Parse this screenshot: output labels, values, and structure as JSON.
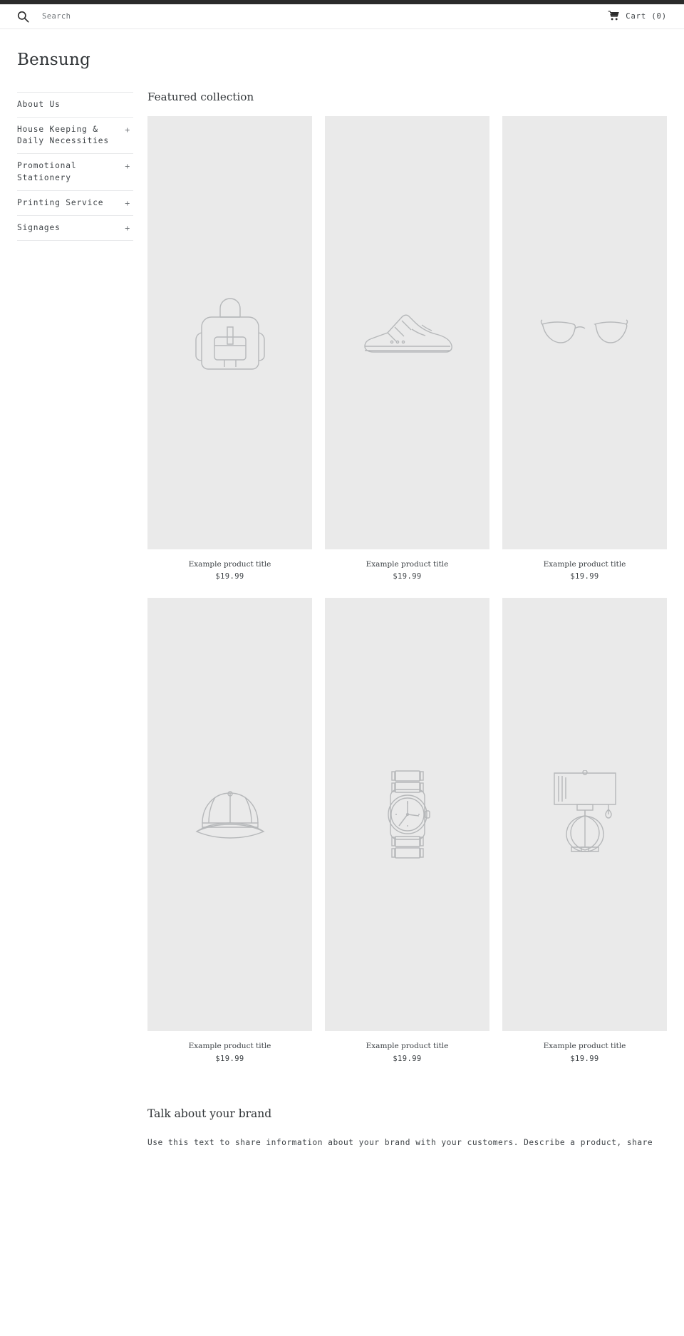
{
  "topbar": {
    "color": "#2b2b2b"
  },
  "header": {
    "search": {
      "icon": "search-icon",
      "placeholder": "Search",
      "value": ""
    },
    "cart": {
      "icon": "shopping-cart-icon",
      "label": "Cart (0)",
      "count": 0
    },
    "logo": "Bensung"
  },
  "sidebar": {
    "items": [
      {
        "label": "About Us",
        "expander": ""
      },
      {
        "label": "House Keeping & Daily Necessities",
        "expander": "+"
      },
      {
        "label": "Promotional Stationery",
        "expander": "+"
      },
      {
        "label": "Printing Service",
        "expander": "+"
      },
      {
        "label": "Signages",
        "expander": "+"
      }
    ]
  },
  "main": {
    "featured": {
      "title": "Featured collection",
      "products": [
        {
          "icon": "backpack-icon",
          "title": "Example product title",
          "price": "$19.99"
        },
        {
          "icon": "sneaker-icon",
          "title": "Example product title",
          "price": "$19.99"
        },
        {
          "icon": "eyeglasses-icon",
          "title": "Example product title",
          "price": "$19.99"
        },
        {
          "icon": "baseball-cap-icon",
          "title": "Example product title",
          "price": "$19.99"
        },
        {
          "icon": "wristwatch-icon",
          "title": "Example product title",
          "price": "$19.99"
        },
        {
          "icon": "table-lamp-icon",
          "title": "Example product title",
          "price": "$19.99"
        }
      ]
    },
    "richtext": {
      "heading": "Talk about your brand",
      "body": "Use this text to share information about your brand with your customers. Describe a product, share"
    }
  },
  "colors": {
    "placeholder_bg": "#eaeaea",
    "placeholder_stroke": "#b6b8ba",
    "text": "#3d4246",
    "rule": "#e8e9eb"
  }
}
